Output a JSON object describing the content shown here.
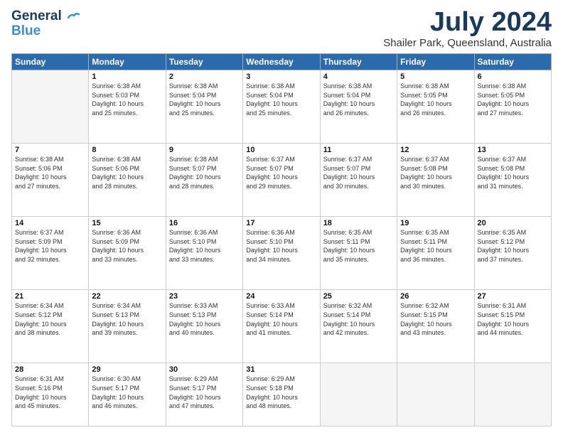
{
  "header": {
    "logo_line1": "General",
    "logo_line2": "Blue",
    "month": "July 2024",
    "location": "Shailer Park, Queensland, Australia"
  },
  "weekdays": [
    "Sunday",
    "Monday",
    "Tuesday",
    "Wednesday",
    "Thursday",
    "Friday",
    "Saturday"
  ],
  "weeks": [
    [
      {
        "day": "",
        "info": ""
      },
      {
        "day": "1",
        "info": "Sunrise: 6:38 AM\nSunset: 5:03 PM\nDaylight: 10 hours\nand 25 minutes."
      },
      {
        "day": "2",
        "info": "Sunrise: 6:38 AM\nSunset: 5:04 PM\nDaylight: 10 hours\nand 25 minutes."
      },
      {
        "day": "3",
        "info": "Sunrise: 6:38 AM\nSunset: 5:04 PM\nDaylight: 10 hours\nand 25 minutes."
      },
      {
        "day": "4",
        "info": "Sunrise: 6:38 AM\nSunset: 5:04 PM\nDaylight: 10 hours\nand 26 minutes."
      },
      {
        "day": "5",
        "info": "Sunrise: 6:38 AM\nSunset: 5:05 PM\nDaylight: 10 hours\nand 26 minutes."
      },
      {
        "day": "6",
        "info": "Sunrise: 6:38 AM\nSunset: 5:05 PM\nDaylight: 10 hours\nand 27 minutes."
      }
    ],
    [
      {
        "day": "7",
        "info": "Sunrise: 6:38 AM\nSunset: 5:06 PM\nDaylight: 10 hours\nand 27 minutes."
      },
      {
        "day": "8",
        "info": "Sunrise: 6:38 AM\nSunset: 5:06 PM\nDaylight: 10 hours\nand 28 minutes."
      },
      {
        "day": "9",
        "info": "Sunrise: 6:38 AM\nSunset: 5:07 PM\nDaylight: 10 hours\nand 28 minutes."
      },
      {
        "day": "10",
        "info": "Sunrise: 6:37 AM\nSunset: 5:07 PM\nDaylight: 10 hours\nand 29 minutes."
      },
      {
        "day": "11",
        "info": "Sunrise: 6:37 AM\nSunset: 5:07 PM\nDaylight: 10 hours\nand 30 minutes."
      },
      {
        "day": "12",
        "info": "Sunrise: 6:37 AM\nSunset: 5:08 PM\nDaylight: 10 hours\nand 30 minutes."
      },
      {
        "day": "13",
        "info": "Sunrise: 6:37 AM\nSunset: 5:08 PM\nDaylight: 10 hours\nand 31 minutes."
      }
    ],
    [
      {
        "day": "14",
        "info": "Sunrise: 6:37 AM\nSunset: 5:09 PM\nDaylight: 10 hours\nand 32 minutes."
      },
      {
        "day": "15",
        "info": "Sunrise: 6:36 AM\nSunset: 5:09 PM\nDaylight: 10 hours\nand 33 minutes."
      },
      {
        "day": "16",
        "info": "Sunrise: 6:36 AM\nSunset: 5:10 PM\nDaylight: 10 hours\nand 33 minutes."
      },
      {
        "day": "17",
        "info": "Sunrise: 6:36 AM\nSunset: 5:10 PM\nDaylight: 10 hours\nand 34 minutes."
      },
      {
        "day": "18",
        "info": "Sunrise: 6:35 AM\nSunset: 5:11 PM\nDaylight: 10 hours\nand 35 minutes."
      },
      {
        "day": "19",
        "info": "Sunrise: 6:35 AM\nSunset: 5:11 PM\nDaylight: 10 hours\nand 36 minutes."
      },
      {
        "day": "20",
        "info": "Sunrise: 6:35 AM\nSunset: 5:12 PM\nDaylight: 10 hours\nand 37 minutes."
      }
    ],
    [
      {
        "day": "21",
        "info": "Sunrise: 6:34 AM\nSunset: 5:12 PM\nDaylight: 10 hours\nand 38 minutes."
      },
      {
        "day": "22",
        "info": "Sunrise: 6:34 AM\nSunset: 5:13 PM\nDaylight: 10 hours\nand 39 minutes."
      },
      {
        "day": "23",
        "info": "Sunrise: 6:33 AM\nSunset: 5:13 PM\nDaylight: 10 hours\nand 40 minutes."
      },
      {
        "day": "24",
        "info": "Sunrise: 6:33 AM\nSunset: 5:14 PM\nDaylight: 10 hours\nand 41 minutes."
      },
      {
        "day": "25",
        "info": "Sunrise: 6:32 AM\nSunset: 5:14 PM\nDaylight: 10 hours\nand 42 minutes."
      },
      {
        "day": "26",
        "info": "Sunrise: 6:32 AM\nSunset: 5:15 PM\nDaylight: 10 hours\nand 43 minutes."
      },
      {
        "day": "27",
        "info": "Sunrise: 6:31 AM\nSunset: 5:15 PM\nDaylight: 10 hours\nand 44 minutes."
      }
    ],
    [
      {
        "day": "28",
        "info": "Sunrise: 6:31 AM\nSunset: 5:16 PM\nDaylight: 10 hours\nand 45 minutes."
      },
      {
        "day": "29",
        "info": "Sunrise: 6:30 AM\nSunset: 5:17 PM\nDaylight: 10 hours\nand 46 minutes."
      },
      {
        "day": "30",
        "info": "Sunrise: 6:29 AM\nSunset: 5:17 PM\nDaylight: 10 hours\nand 47 minutes."
      },
      {
        "day": "31",
        "info": "Sunrise: 6:29 AM\nSunset: 5:18 PM\nDaylight: 10 hours\nand 48 minutes."
      },
      {
        "day": "",
        "info": ""
      },
      {
        "day": "",
        "info": ""
      },
      {
        "day": "",
        "info": ""
      }
    ]
  ]
}
